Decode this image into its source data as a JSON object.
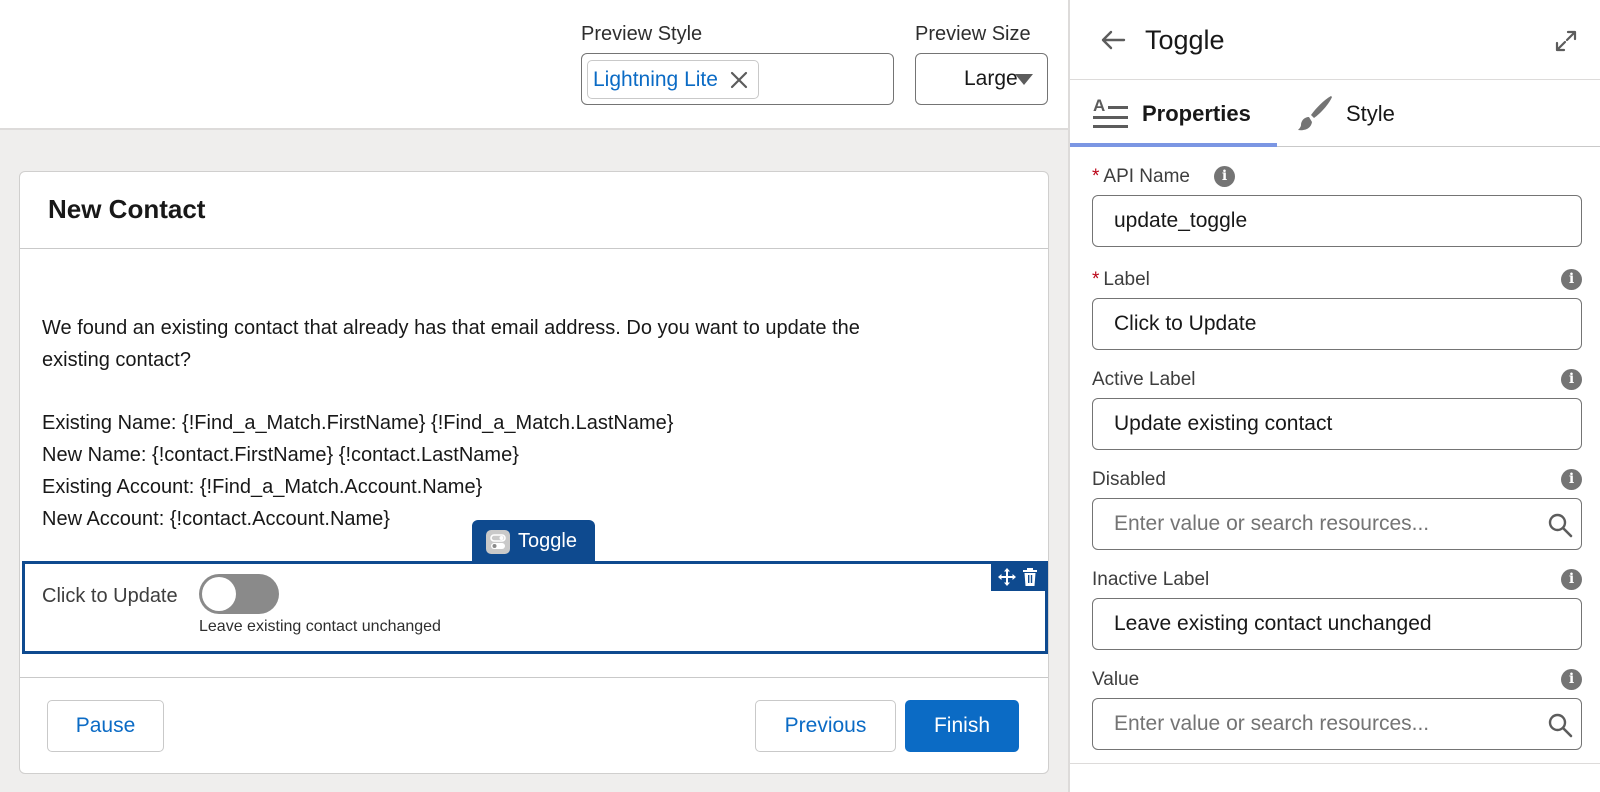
{
  "header": {
    "preview_style_label": "Preview Style",
    "preview_style_value": "Lightning Lite",
    "preview_size_label": "Preview Size",
    "preview_size_value": "Large"
  },
  "screen": {
    "title": "New Contact",
    "message_line1": "We found an existing contact that already has that email address. Do you want to update the",
    "message_line2": "existing contact?",
    "detail_lines": [
      "Existing Name: {!Find_a_Match.FirstName} {!Find_a_Match.LastName}",
      "New Name: {!contact.FirstName} {!contact.LastName}",
      "Existing Account: {!Find_a_Match.Account.Name}",
      "New Account: {!contact.Account.Name}"
    ],
    "component_tab_label": "Toggle",
    "toggle": {
      "label": "Click to Update",
      "state_caption": "Leave existing contact unchanged",
      "checked": false
    },
    "buttons": {
      "pause": "Pause",
      "previous": "Previous",
      "finish": "Finish"
    }
  },
  "panel": {
    "title": "Toggle",
    "tabs": [
      {
        "label": "Properties",
        "active": true,
        "icon": "text-lines-icon"
      },
      {
        "label": "Style",
        "active": false,
        "icon": "paintbrush-icon"
      }
    ],
    "fields": {
      "api_name": {
        "label": "API Name",
        "required": true,
        "value": "update_toggle"
      },
      "label": {
        "label": "Label",
        "required": true,
        "value": "Click to Update"
      },
      "active_label": {
        "label": "Active Label",
        "required": false,
        "value": "Update existing contact"
      },
      "disabled": {
        "label": "Disabled",
        "required": false,
        "placeholder": "Enter value or search resources..."
      },
      "inactive_label": {
        "label": "Inactive Label",
        "required": false,
        "value": "Leave existing contact unchanged"
      },
      "value": {
        "label": "Value",
        "required": false,
        "placeholder": "Enter value or search resources..."
      }
    }
  },
  "colors": {
    "brand": "#0b6bc5",
    "selection": "#0e4a8f",
    "tab_underline": "#7b96e3",
    "required": "#ba0517"
  }
}
